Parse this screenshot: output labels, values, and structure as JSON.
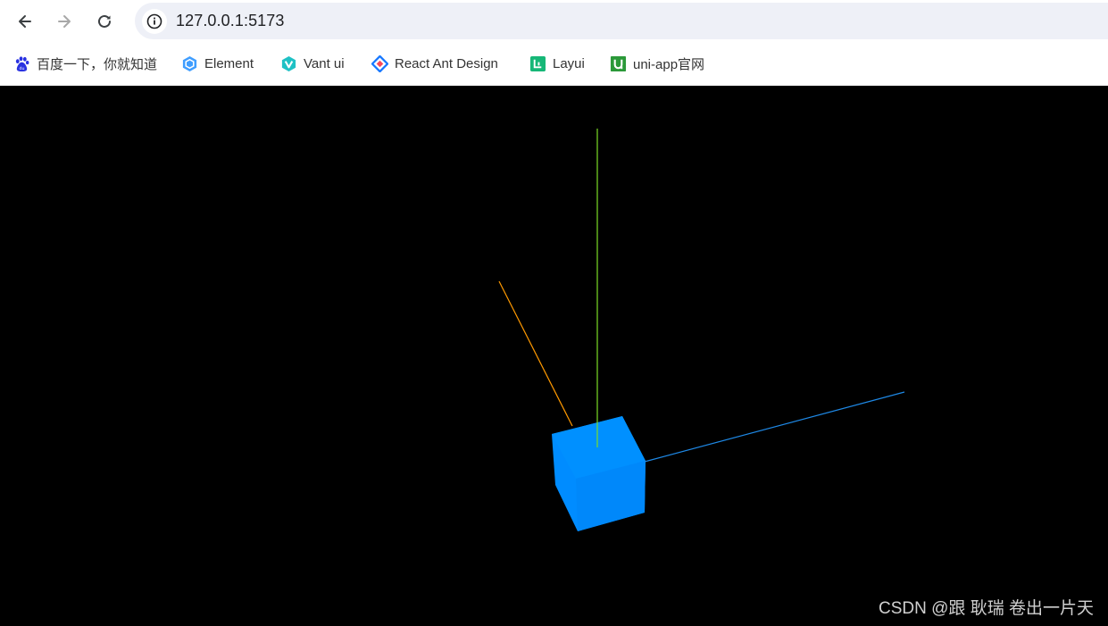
{
  "browser": {
    "url": "127.0.0.1:5173",
    "bookmarks": [
      {
        "label": "百度一下，你就知道",
        "icon": "baidu-paw-icon"
      },
      {
        "label": "Element",
        "icon": "element-hexagon-icon"
      },
      {
        "label": "Vant ui",
        "icon": "vant-logo-icon"
      },
      {
        "label": "React Ant Design",
        "icon": "ant-design-diamond-icon"
      },
      {
        "label": "Layui",
        "icon": "layui-logo-icon"
      },
      {
        "label": "uni-app官网",
        "icon": "uniapp-logo-icon"
      }
    ]
  },
  "scene": {
    "background": "#000000",
    "cube_color": "#008cff",
    "axes": {
      "x_color": "#1e88e5",
      "y_color": "#7cdc24",
      "z_color": "#ff9900"
    }
  },
  "watermark": "CSDN @跟 耿瑞 卷出一片天"
}
